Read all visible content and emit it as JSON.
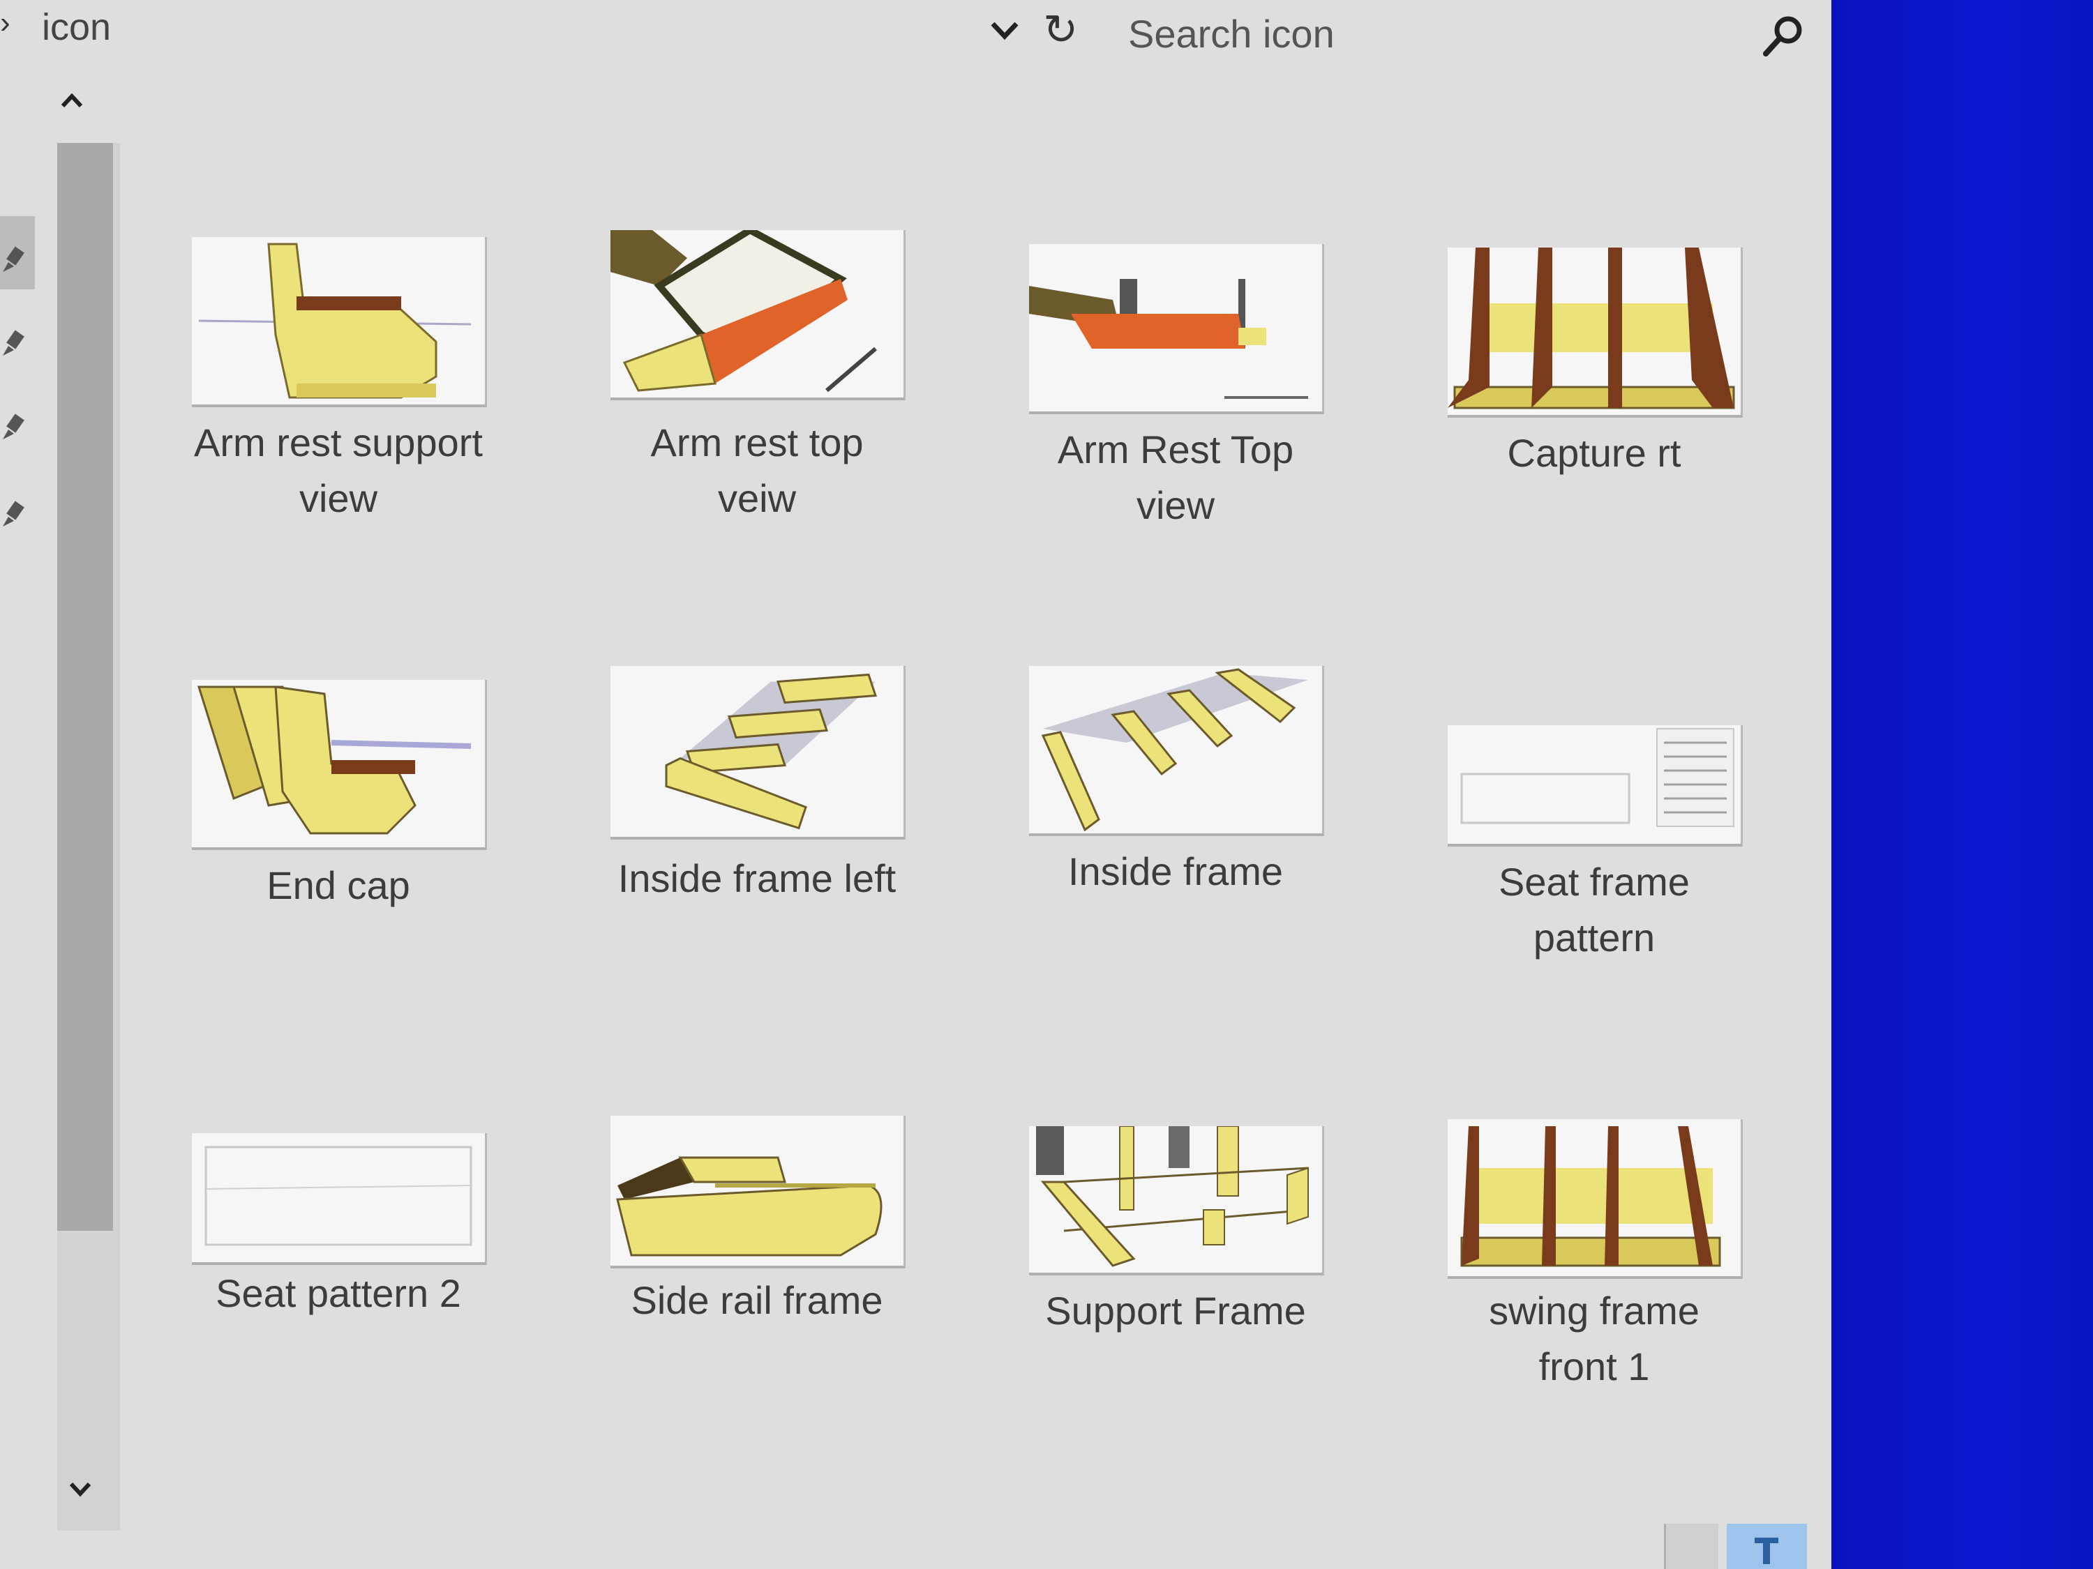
{
  "window": {
    "breadcrumb": {
      "chevron": "›",
      "folder": "icon"
    },
    "refresh_glyph": "↻",
    "search": {
      "placeholder": "Search icon"
    }
  },
  "files": [
    {
      "name": "Arm rest support view",
      "line1": "Arm rest support",
      "line2": "view"
    },
    {
      "name": "Arm rest top veiw",
      "line1": "Arm rest top",
      "line2": "veiw"
    },
    {
      "name": "Arm Rest Top view",
      "line1": "Arm Rest Top",
      "line2": "view"
    },
    {
      "name": "Capture rt",
      "line1": "Capture rt",
      "line2": ""
    },
    {
      "name": "End cap",
      "line1": "End cap",
      "line2": ""
    },
    {
      "name": "Inside frame left",
      "line1": "Inside frame left",
      "line2": ""
    },
    {
      "name": "Inside frame",
      "line1": "Inside frame",
      "line2": ""
    },
    {
      "name": "Seat frame pattern",
      "line1": "Seat frame",
      "line2": "pattern"
    },
    {
      "name": "Seat pattern 2",
      "line1": "Seat pattern 2",
      "line2": ""
    },
    {
      "name": "Side rail frame",
      "line1": "Side rail frame",
      "line2": ""
    },
    {
      "name": "Support Frame",
      "line1": "Support Frame",
      "line2": ""
    },
    {
      "name": "swing frame front 1",
      "line1": "swing frame",
      "line2": "front 1"
    }
  ],
  "colors": {
    "window_bg": "#dedede",
    "desktop_blue": "#0a14c8",
    "wood_yellow": "#e8e070",
    "wood_orange": "#e0642a",
    "wood_dark": "#6b5a2c"
  }
}
